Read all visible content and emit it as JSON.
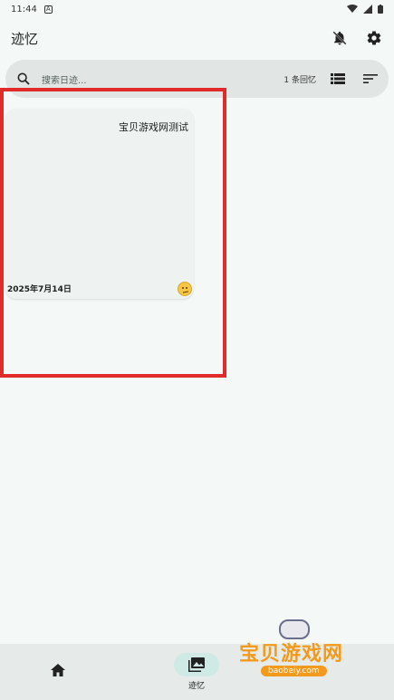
{
  "status": {
    "time": "11:44",
    "a_glyph": "A"
  },
  "appbar": {
    "title": "迹忆"
  },
  "search": {
    "placeholder": "搜索日迹...",
    "count": "1 条回忆"
  },
  "entries": [
    {
      "title": "宝贝游戏网测试",
      "date": "2025年7月14日",
      "mood": "worried-face-icon"
    }
  ],
  "nav": {
    "memory_label": "迹忆"
  },
  "watermark": {
    "text": "宝贝游戏网",
    "url": "baobeiy.com"
  },
  "colors": {
    "accent": "#cfe9e4",
    "highlight": "#e02b2b",
    "background": "#f4f9f7"
  }
}
